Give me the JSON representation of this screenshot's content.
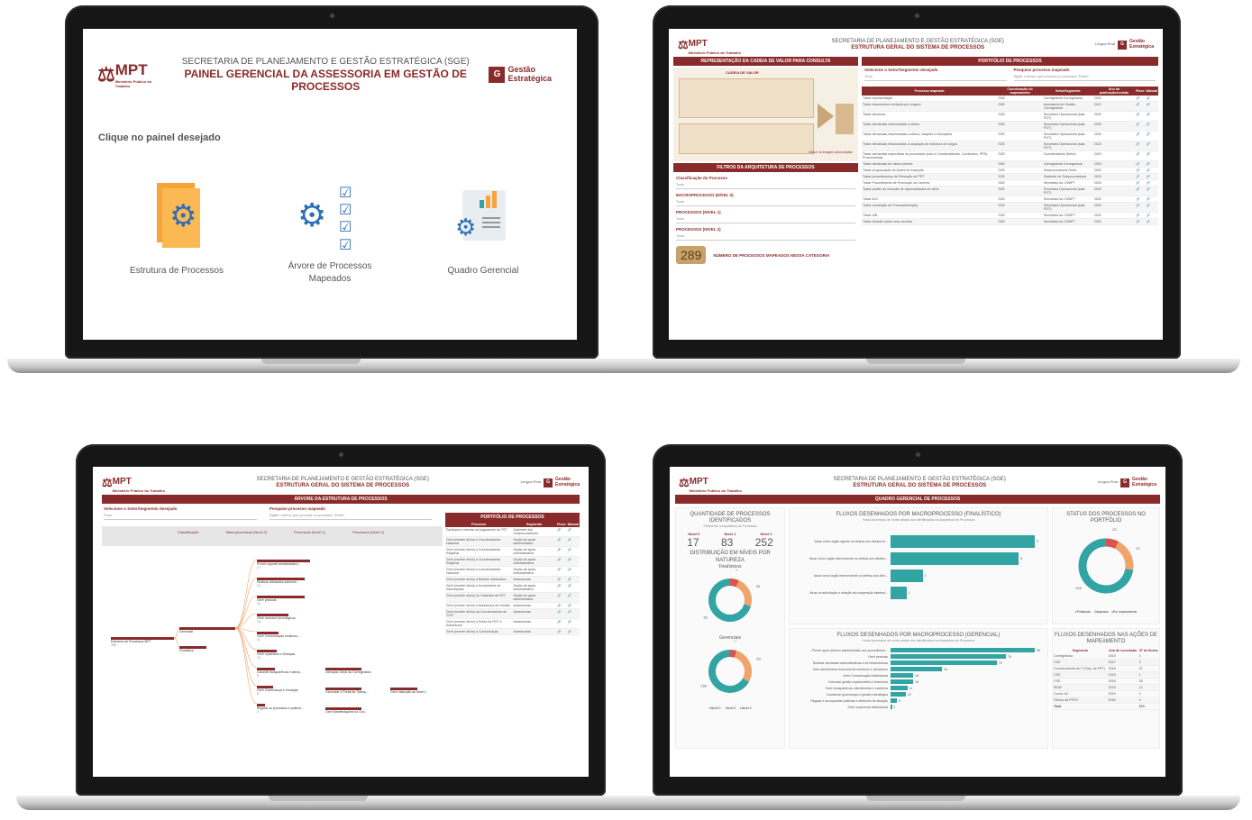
{
  "brand": {
    "logo": "MPT",
    "logo_sub": "Ministério Público do Trabalho",
    "ge": "Gestão Estratégica",
    "ge_short": "Gestão\nEstratégica",
    "sgE_short": "Lingua Fina"
  },
  "home": {
    "title1": "SECRETARIA DE PLANEJAMENTO E GESTÃO ESTRATÉGICA (SGE)",
    "title2": "PAINEL GERENCIAL DA ASSESSORIA EM GESTÃO DE PROCESSOS",
    "prompt": "Clique no painel desejado",
    "cards": [
      {
        "label": "Estrutura de Processos"
      },
      {
        "label": "Árvore de Processos Mapeados"
      },
      {
        "label": "Quadro Gerencial"
      }
    ]
  },
  "s2": {
    "title1": "SECRETARIA DE PLANEJAMENTO E GESTÃO ESTRATÉGICA (SGE)",
    "title2": "ESTRUTURA GERAL DO SISTEMA DE PROCESSOS",
    "bar_left": "REPRESENTAÇÃO DA CADEIA DE VALOR PARA CONSULTA",
    "cadeia": "CADEIA DE VALOR",
    "clique": "Clique na imagem para ampliar",
    "filters_bar": "FILTROS DA ARQUITETURA DE PROCESSOS",
    "f1": "Classificação do Processo",
    "f2": "MACROPROCESSO (NÍVEL 0)",
    "f3": "PROCESSOS (NÍVEL 1)",
    "f4": "PROCESSOS (NÍVEL 2)",
    "tudo": "Tudo",
    "count": "289",
    "count_label": "NÚMERO DE PROCESSOS MAPEADOS NESSA CATEGORIA",
    "bar_right": "PORTFÓLIO DE PROCESSOS",
    "sel_label": "Selecione o Setor/Segmento desejado",
    "search_label": "Pesquise processo mapeado",
    "search_ph": "Digite o termo que procura no processo \"Entre\"",
    "cols": [
      "Processo mapeado",
      "Coordenação do mapeamento",
      "Setor/Segmento",
      "Ano da publicação/revisão",
      "Fluxo",
      "Manual"
    ],
    "rows": [
      [
        "Tratar representação",
        "SGE",
        "Corregedoria Corregedoria",
        "2020"
      ],
      [
        "Tratar documentos enviados por engano",
        "SGE",
        "Assessoria de Gestão Corregedoria",
        "2021"
      ],
      [
        "Tratar denúncia",
        "SGE",
        "Secretaria Operacional (sala PGT)",
        "2020"
      ],
      [
        "Tratar demandas relacionadas a ofícios",
        "SGE",
        "Secretaria Operacional (sala PGT)",
        "2020"
      ],
      [
        "Tratar demandas relacionadas a ofícios, citações e intimações",
        "SGE",
        "Secretaria Operacional (sala PGT)",
        "2020"
      ],
      [
        "Tratar demandas relacionadas a ocupação de estrutura de cargos",
        "SGE",
        "Secretaria Operacional (sala PGT)",
        "2020"
      ],
      [
        "Tratar demandas específicas do procurador junto a Coordenadorias, Comissões, PRTs, Procuradorias",
        "SGE",
        "Coordenadoria (Setor)",
        "2020"
      ],
      [
        "Tratar demandas de vários setores",
        "SGE",
        "Corregedoria Corregedoria",
        "2020"
      ],
      [
        "Tratar programação de Ações de Inspeção",
        "SGE",
        "Subprocuradoria Geral",
        "2020"
      ],
      [
        "Tratar procedimentos de Remoção de PRT",
        "SGE",
        "Gabinete de Subprocuradoria",
        "2020"
      ],
      [
        "Tratar Procedimento de Promoção na Carreira",
        "SGE",
        "Secretaria do CSMPT",
        "2020"
      ],
      [
        "Tratar pedido de emissão de especialidades de oficio",
        "SGE",
        "Secretaria Operacional (sala PGT)",
        "2020"
      ],
      [
        "Tratar AVC",
        "SGE",
        "Secretaria do CSMPT",
        "2020"
      ],
      [
        "Tratar nomeação de Procuradores(as)",
        "SGE",
        "Secretaria Operacional (sala PGT)",
        "2020"
      ],
      [
        "Tratar IAB",
        "SGE",
        "Secretaria do CSMPT",
        "2022"
      ],
      [
        "Tratar decisão sobre novo servidor",
        "SGE",
        "Secretaria do CSMPT",
        "2022"
      ]
    ]
  },
  "s3": {
    "title1": "SECRETARIA DE PLANEJAMENTO E GESTÃO ESTRATÉGICA (SGE)",
    "title2": "ESTRUTURA GERAL DO SISTEMA DE PROCESSOS",
    "bar": "ÁRVORE DA ESTRUTURA DE PROCESSOS",
    "sel_label": "Selecione o Setor/Segmento desejado",
    "search_label": "Pesquise processo mapeado",
    "search_ph": "Digite o termo que procura no processo \"Entre\"",
    "tudo": "Tudo",
    "tree_cols": [
      "Classificação",
      "Macroprocessos (Nível 0)",
      "Processos (Nível 1)",
      "Processos (Nível 2)"
    ],
    "root": "Estrutura de Processos MPT",
    "root_val": "289",
    "n1a": "Gerencial",
    "n1b": "Finalística",
    "n2": [
      "Prover suporte administrativo...",
      "Realizar atividades administ...",
      "Gerir pessoas",
      "Gerir recursos tecnológicos",
      "Gerir Comunicação Institucio...",
      "Gerir orçamento e finanças",
      "Garantir transparência e atend...",
      "Gerir Governança e Inovação",
      "Regular os processos e política..."
    ],
    "n2vals": [
      "27",
      "24",
      "24",
      "16",
      "11",
      "10",
      "9",
      "8",
      "4"
    ],
    "n3": [
      "Interação Geral da Corregedoria",
      "Gerenciar o Portal da Transp...",
      "Gerir Manifestações na Ouv..."
    ],
    "n4": "Gerir Instrução ao Nível 2",
    "bar_right": "PORTFÓLIO DE PROCESSOS",
    "cols": [
      "Processo",
      "Segmento",
      "Fluxo",
      "Manual"
    ],
    "rows": [
      [
        "Participar e orientar do julgamento do TST",
        "Gabinete dos Subprocuradores"
      ],
      [
        "Gerir (recebe ofício) a Coordenadoria Nacional",
        "Seção de apoio administrativo"
      ],
      [
        "Gerir (recebe ofício) a Coordenadoria Regional",
        "Seção de apoio Administrativa"
      ],
      [
        "Gerir (recebe ofício) a Coordenadoria Regional",
        "Seção de apoio Administrativa"
      ],
      [
        "Gerir (recebe ofício) a Coordenadoria Nacional",
        "Seção de apoio Administrativa"
      ],
      [
        "Gerir (recebe ofício) a Boletim informativo",
        "Assessorias"
      ],
      [
        "Gerir (recebe ofício) a funcionários de informações",
        "Seção de apoio Administrativo"
      ],
      [
        "Gerir (recebe ofício) do Gabinete da PGT",
        "Seção de apoio administrativo"
      ],
      [
        "Gerir (recebe ofício) à Assessoria de Gestão",
        "Assessorias"
      ],
      [
        "Gerir (recebe ofício) da Coordenadoria de CCR",
        "Assessorias"
      ],
      [
        "Gerir (recebe ofício) a Ponto de PGT e Assessoria",
        "Assessorias"
      ],
      [
        "Gerir (recebe ofício) a Comunicação",
        "Assessorias"
      ]
    ]
  },
  "s4": {
    "title1": "SECRETARIA DE PLANEJAMENTO E GESTÃO ESTRATÉGICA (SGE)",
    "title2": "ESTRUTURA GERAL DO SISTEMA DE PROCESSOS",
    "bar": "QUADRO GERENCIAL DE PROCESSOS",
    "q_title": "QUANTIDADE DE PROCESSOS IDENTIFICADOS",
    "q_sub": "*Referente à Arquitetura de Processos",
    "levels": [
      {
        "label": "Nível 0",
        "value": "17"
      },
      {
        "label": "Nível 1",
        "value": "83"
      },
      {
        "label": "Nível 2",
        "value": "252"
      }
    ],
    "dist_title": "DISTRIBUIÇÃO EM NÍVEIS POR NATUREZA",
    "finalisticos": "Finalísticos",
    "gerenciais": "Gerenciais",
    "donut1_vals": [
      "6",
      "20",
      "62"
    ],
    "donut2_vals": [
      "11",
      "63",
      "150"
    ],
    "legend": [
      "Nível 0",
      "Nível 1",
      "Nível 2"
    ],
    "fin_title": "FLUXOS DESENHADOS POR MACROPROCESSO (FINALÍSTICO)",
    "fin_sub": "*Inclui processos de níveis abaixo dos identificados na Arquitetura de Processos",
    "fin_bars": [
      {
        "label": "Atuar como órgão agente na defesa dos direitos fu...",
        "value": 9
      },
      {
        "label": "Atuar como órgão interveniente na defesa dos direitos...",
        "value": 8
      },
      {
        "label": "Atuar como órgão interveniente na defesa dos direi...",
        "value": 2
      },
      {
        "label": "Atuar na articulação e relação de cooperação interinst...",
        "value": 1
      }
    ],
    "ger_title": "FLUXOS DESENHADOS POR MACROPROCESSO (GERENCIAL)",
    "ger_sub": "*Inclui processos de níveis abaixo dos identificados na Arquitetura de Processos",
    "ger_bars": [
      {
        "label": "Prover apoio técnico administrativo aos procediment...",
        "value": 95
      },
      {
        "label": "Gerir pessoas",
        "value": 76
      },
      {
        "label": "Realizar atividades administrativas e de infraestrutura",
        "value": 70
      },
      {
        "label": "Gerir atendimento funcional de membros e servidores",
        "value": 34
      },
      {
        "label": "Gerir Comunicação Institucional",
        "value": 15
      },
      {
        "label": "Executar gestão orçamentária e financeira",
        "value": 15
      },
      {
        "label": "Gerir transparência, atendimento e ouvidoria",
        "value": 11
      },
      {
        "label": "Coordenar governança e gestão estratégica",
        "value": 10
      },
      {
        "label": "Regular e acompanhar políticas e diretrizes de atuação",
        "value": 4
      },
      {
        "label": "Gerir orçamento institucional",
        "value": 1
      }
    ],
    "status_title": "STATUS DOS PROCESSOS NO PORTFÓLIO",
    "status_vals": [
      "22",
      "57",
      "209"
    ],
    "status_legend": [
      "Publicado",
      "Mapeado",
      "Em mapeamento"
    ],
    "acoes_title": "FLUXOS DESENHADOS NAS AÇÕES DE MAPEAMENTO",
    "acoes_cols": [
      "Segmento",
      "Ano de conclusão",
      "Nº de fluxos"
    ],
    "acoes_rows": [
      [
        "Corregedoria",
        "2019",
        "3"
      ],
      [
        "CSS",
        "2017",
        "3"
      ],
      [
        "Coordenadoria de TI (Seg. da PRT)",
        "2018",
        "21"
      ],
      [
        "CSS",
        "2019",
        "1"
      ],
      [
        "CSS",
        "2018",
        "35"
      ],
      [
        "SEAF",
        "2019",
        "12"
      ],
      [
        "Coord. AC",
        "2019",
        "4"
      ],
      [
        "Ofícios da PRTS",
        "2018",
        "4"
      ]
    ],
    "acoes_total": [
      "Total",
      "",
      "374"
    ]
  }
}
